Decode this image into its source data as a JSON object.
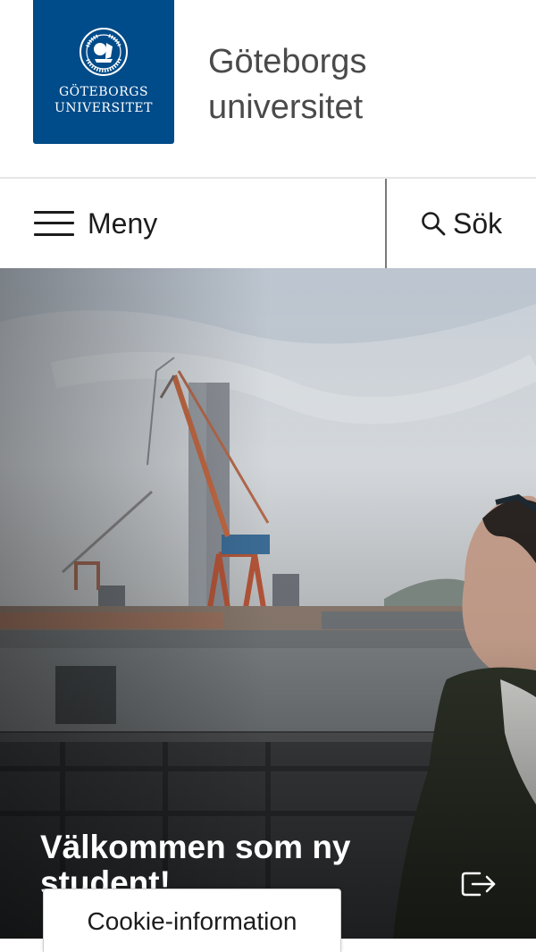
{
  "header": {
    "logo_text_line1": "GÖTEBORGS",
    "logo_text_line2": "UNIVERSITET",
    "wordmark_line1": "Göteborgs",
    "wordmark_line2": "universitet",
    "logo_color": "#004b89"
  },
  "navbar": {
    "menu_label": "Meny",
    "menu_icon": "hamburger-icon",
    "search_label": "Sök",
    "search_icon": "search-icon"
  },
  "hero": {
    "title": "Välkommen som ny student!",
    "link_icon": "external-link-icon"
  },
  "cookie": {
    "label": "Cookie-information"
  }
}
